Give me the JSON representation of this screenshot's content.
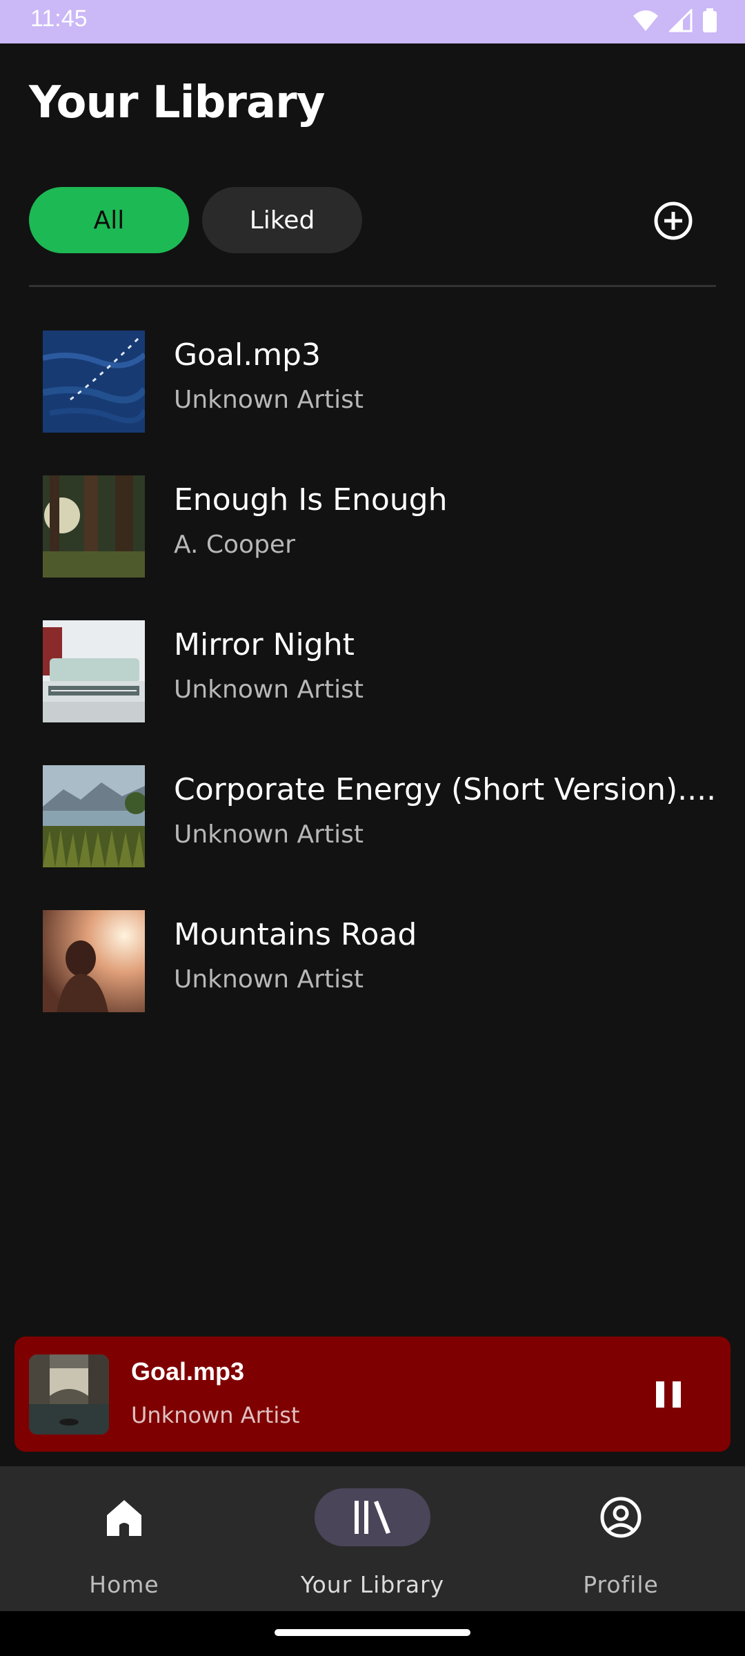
{
  "status_bar": {
    "time": "11:45",
    "icons": [
      "wifi-icon",
      "signal-icon",
      "battery-icon"
    ]
  },
  "page": {
    "title": "Your Library"
  },
  "filters": {
    "all_label": "All",
    "liked_label": "Liked",
    "selected": "All"
  },
  "tracks": [
    {
      "title": "Goal.mp3",
      "artist": "Unknown Artist"
    },
    {
      "title": "Enough Is Enough",
      "artist": "A. Cooper"
    },
    {
      "title": "Mirror Night",
      "artist": "Unknown Artist"
    },
    {
      "title": "Corporate Energy (Short Version)....",
      "artist": "Unknown Artist"
    },
    {
      "title": "Mountains Road",
      "artist": "Unknown Artist"
    }
  ],
  "mini_player": {
    "title": "Goal.mp3",
    "artist": "Unknown Artist",
    "state": "playing"
  },
  "bottom_nav": {
    "items": [
      {
        "label": "Home",
        "icon": "home-icon"
      },
      {
        "label": "Your Library",
        "icon": "library-icon"
      },
      {
        "label": "Profile",
        "icon": "profile-icon"
      }
    ],
    "active": "Your Library"
  },
  "colors": {
    "accent": "#1db954",
    "mini_player_bg": "#7f0000",
    "background": "#121212",
    "status_bar": "#cbb8f7"
  }
}
